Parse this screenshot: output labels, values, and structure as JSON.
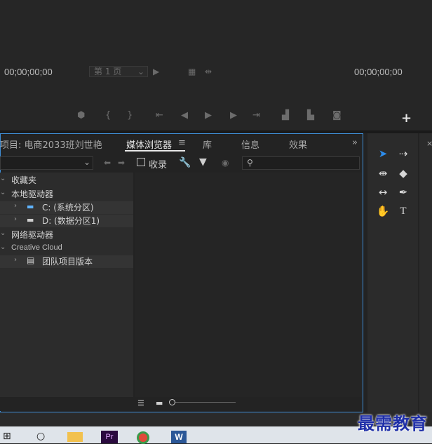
{
  "monitor": {
    "timecode_in": "00;00;00;00",
    "timecode_out": "00;00;00;00",
    "page_select": "第 1 页"
  },
  "panel": {
    "project_tab": "项目: 电商2033班刘世艳",
    "tabs": [
      "媒体浏览器",
      "库",
      "信息",
      "效果"
    ],
    "active_tab": "媒体浏览器",
    "ingest_label": "收录",
    "tree": {
      "favorites": "收藏夹",
      "local_drives": "本地驱动器",
      "drive_c": "C: (系统分区)",
      "drive_d": "D: (数据分区1)",
      "network_drives": "网络驱动器",
      "creative_cloud": "Creative Cloud",
      "team_versions": "团队项目版本"
    }
  },
  "watermark": "最需教育",
  "colors": {
    "accent": "#3f8fd8",
    "tool_selected": "#2d8ceb",
    "watermark": "#1f2fa8"
  }
}
